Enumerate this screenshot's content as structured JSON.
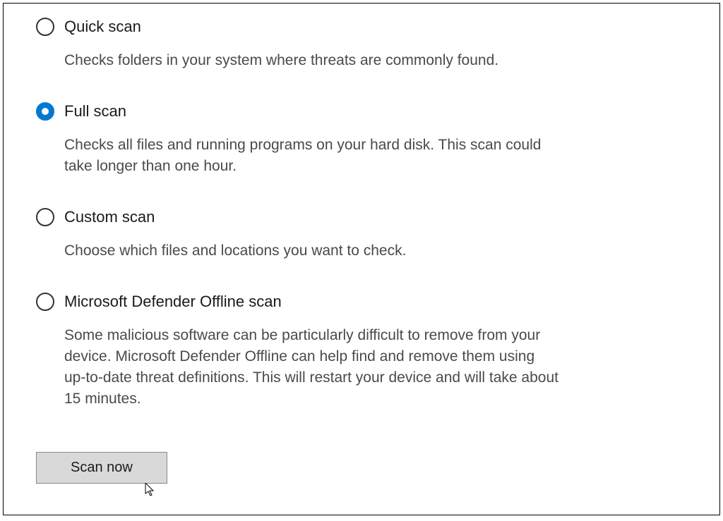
{
  "scanOptions": [
    {
      "id": "quick",
      "label": "Quick scan",
      "description": "Checks folders in your system where threats are commonly found.",
      "selected": false
    },
    {
      "id": "full",
      "label": "Full scan",
      "description": "Checks all files and running programs on your hard disk. This scan could take longer than one hour.",
      "selected": true
    },
    {
      "id": "custom",
      "label": "Custom scan",
      "description": "Choose which files and locations you want to check.",
      "selected": false
    },
    {
      "id": "offline",
      "label": "Microsoft Defender Offline scan",
      "description": "Some malicious software can be particularly difficult to remove from your device. Microsoft Defender Offline can help find and remove them using up-to-date threat definitions. This will restart your device and will take about 15 minutes.",
      "selected": false
    }
  ],
  "scanButton": {
    "label": "Scan now"
  }
}
